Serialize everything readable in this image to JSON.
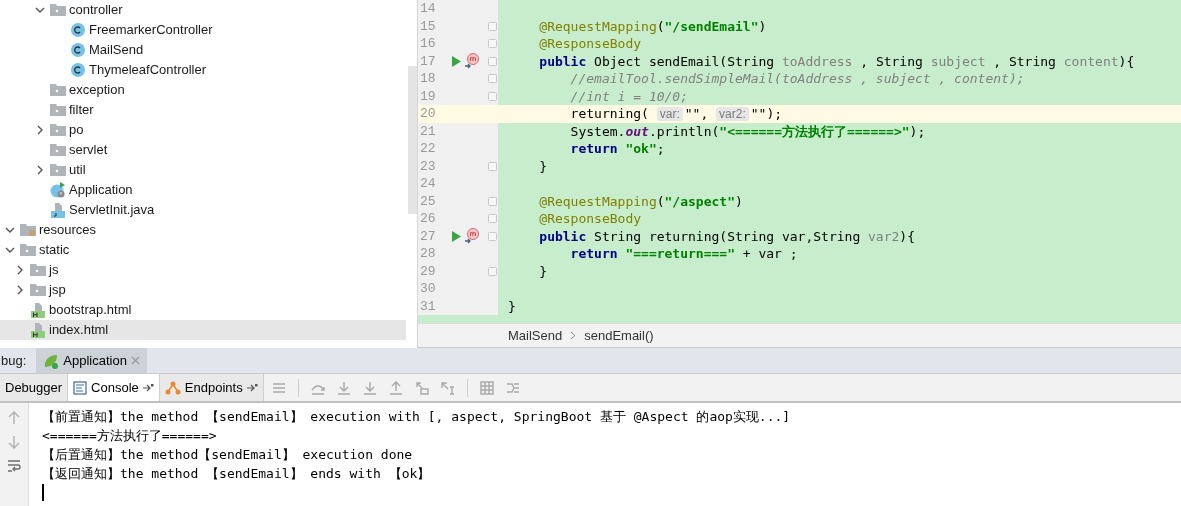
{
  "project_tree": {
    "items": [
      {
        "children": [
          {
            "children": [
              {
                "children": [
                  {
                    "label": "controller",
                    "kind": "folder",
                    "expanded": true,
                    "selected": false,
                    "children": [
                      {
                        "label": "FreemarkerController",
                        "kind": "class",
                        "selected": false
                      },
                      {
                        "label": "MailSend",
                        "kind": "class",
                        "selected": false
                      },
                      {
                        "label": "ThymeleafController",
                        "kind": "class",
                        "selected": false
                      }
                    ]
                  },
                  {
                    "label": "exception",
                    "kind": "folder",
                    "selected": false
                  },
                  {
                    "label": "filter",
                    "kind": "folder",
                    "selected": false
                  },
                  {
                    "label": "po",
                    "kind": "folder",
                    "expanded": false,
                    "selected": false
                  },
                  {
                    "label": "servlet",
                    "kind": "folder",
                    "selected": false
                  },
                  {
                    "label": "util",
                    "kind": "folder",
                    "expanded": false,
                    "selected": false
                  },
                  {
                    "label": "Application",
                    "kind": "app",
                    "selected": false
                  },
                  {
                    "label": "ServletInit.java",
                    "kind": "java",
                    "selected": false
                  }
                ]
              }
            ]
          }
        ]
      },
      {
        "label": "resources",
        "kind": "resources",
        "expanded": true,
        "selected": false,
        "children": [
          {
            "label": "static",
            "kind": "folder",
            "expanded": true,
            "selected": false,
            "children": [
              {
                "label": "js",
                "kind": "folder",
                "expanded": false,
                "selected": false
              },
              {
                "label": "jsp",
                "kind": "folder",
                "expanded": false,
                "selected": false
              },
              {
                "label": "bootstrap.html",
                "kind": "html",
                "selected": false
              },
              {
                "label": "index.html",
                "kind": "html",
                "selected": true
              }
            ]
          }
        ]
      }
    ]
  },
  "editor": {
    "lines": [
      {
        "number": "14",
        "current": false,
        "run": false,
        "fold": false
      },
      {
        "number": "15",
        "current": false,
        "run": false,
        "fold": true,
        "tokens": [
          {
            "kind": "ann",
            "text": "    @RequestMapping"
          },
          {
            "kind": "plain",
            "text": "("
          },
          {
            "kind": "str",
            "text": "\"/sendEmail\""
          },
          {
            "kind": "plain",
            "text": ")"
          }
        ]
      },
      {
        "number": "16",
        "current": false,
        "run": false,
        "fold": true,
        "tokens": [
          {
            "kind": "ann",
            "text": "    @ResponseBody"
          }
        ]
      },
      {
        "number": "17",
        "current": false,
        "run": true,
        "fold": true,
        "tokens": [
          {
            "kind": "kw",
            "text": "    public"
          },
          {
            "kind": "plain",
            "text": " Object sendEmail(String "
          },
          {
            "kind": "param",
            "text": "toAddress"
          },
          {
            "kind": "plain",
            "text": " , String "
          },
          {
            "kind": "param",
            "text": "subject"
          },
          {
            "kind": "plain",
            "text": " , String "
          },
          {
            "kind": "param",
            "text": "content"
          },
          {
            "kind": "plain",
            "text": "){"
          }
        ]
      },
      {
        "number": "18",
        "current": false,
        "run": false,
        "fold": true,
        "tokens": [
          {
            "kind": "com",
            "text": "        //emailTool.sendSimpleMail(toAddress , subject , content);"
          }
        ]
      },
      {
        "number": "19",
        "current": false,
        "run": false,
        "fold": true,
        "tokens": [
          {
            "kind": "com",
            "text": "        //int i = 10/0;"
          }
        ]
      },
      {
        "number": "20",
        "current": true,
        "run": false,
        "fold": false,
        "tokens": [
          {
            "kind": "plain",
            "text": "        returning( "
          },
          {
            "kind": "hint",
            "text": "var:"
          },
          {
            "kind": "plain",
            "text": "\"\", "
          },
          {
            "kind": "hint",
            "text": "var2:"
          },
          {
            "kind": "plain",
            "text": "\"\");"
          }
        ]
      },
      {
        "number": "21",
        "current": false,
        "run": false,
        "fold": false,
        "tokens": [
          {
            "kind": "plain",
            "text": "        System."
          },
          {
            "kind": "static",
            "text": "out"
          },
          {
            "kind": "plain",
            "text": ".println("
          },
          {
            "kind": "str",
            "text": "\"<======方法执行了======>\""
          },
          {
            "kind": "plain",
            "text": ");"
          }
        ]
      },
      {
        "number": "22",
        "current": false,
        "run": false,
        "fold": false,
        "tokens": [
          {
            "kind": "kw",
            "text": "        return "
          },
          {
            "kind": "str",
            "text": "\"ok\""
          },
          {
            "kind": "plain",
            "text": ";"
          }
        ]
      },
      {
        "number": "23",
        "current": false,
        "run": false,
        "fold": true,
        "tokens": [
          {
            "kind": "plain",
            "text": "    }"
          }
        ]
      },
      {
        "number": "24",
        "current": false,
        "run": false,
        "fold": false
      },
      {
        "number": "25",
        "current": false,
        "run": false,
        "fold": true,
        "tokens": [
          {
            "kind": "ann",
            "text": "    @RequestMapping"
          },
          {
            "kind": "plain",
            "text": "("
          },
          {
            "kind": "str",
            "text": "\"/aspect\""
          },
          {
            "kind": "plain",
            "text": ")"
          }
        ]
      },
      {
        "number": "26",
        "current": false,
        "run": false,
        "fold": true,
        "tokens": [
          {
            "kind": "ann",
            "text": "    @ResponseBody"
          }
        ]
      },
      {
        "number": "27",
        "current": false,
        "run": true,
        "fold": true,
        "tokens": [
          {
            "kind": "kw",
            "text": "    public"
          },
          {
            "kind": "plain",
            "text": " String returning(String var,String "
          },
          {
            "kind": "param",
            "text": "var2"
          },
          {
            "kind": "plain",
            "text": "){"
          }
        ]
      },
      {
        "number": "28",
        "current": false,
        "run": false,
        "fold": false,
        "tokens": [
          {
            "kind": "kw",
            "text": "        return "
          },
          {
            "kind": "str",
            "text": "\"===return===\""
          },
          {
            "kind": "plain",
            "text": " + var ;"
          }
        ]
      },
      {
        "number": "29",
        "current": false,
        "run": false,
        "fold": true,
        "tokens": [
          {
            "kind": "plain",
            "text": "    }"
          }
        ]
      },
      {
        "number": "30",
        "current": false,
        "run": false,
        "fold": false
      },
      {
        "number": "31",
        "current": false,
        "run": false,
        "fold": false,
        "tokens": [
          {
            "kind": "plain",
            "text": "}"
          }
        ]
      }
    ],
    "breadcrumb": [
      "MailSend",
      "sendEmail()"
    ]
  },
  "debug_panel": {
    "label": "bug:",
    "session_tabs": [
      {
        "label": "Application",
        "selected": true
      }
    ],
    "tabs": [
      {
        "label": "Debugger",
        "kind": "plain",
        "selected": false
      },
      {
        "label": "Console",
        "kind": "console",
        "selected": true
      },
      {
        "label": "Endpoints",
        "kind": "endpoints",
        "selected": false
      }
    ],
    "console_lines": [
      "【前置通知】the method 【sendEmail】 execution with [, aspect, SpringBoot 基于 @Aspect 的aop实现...]",
      "<======方法执行了======>",
      "【后置通知】the method【sendEmail】 execution done",
      "【返回通知】the method 【sendEmail】 ends with 【ok】"
    ]
  }
}
